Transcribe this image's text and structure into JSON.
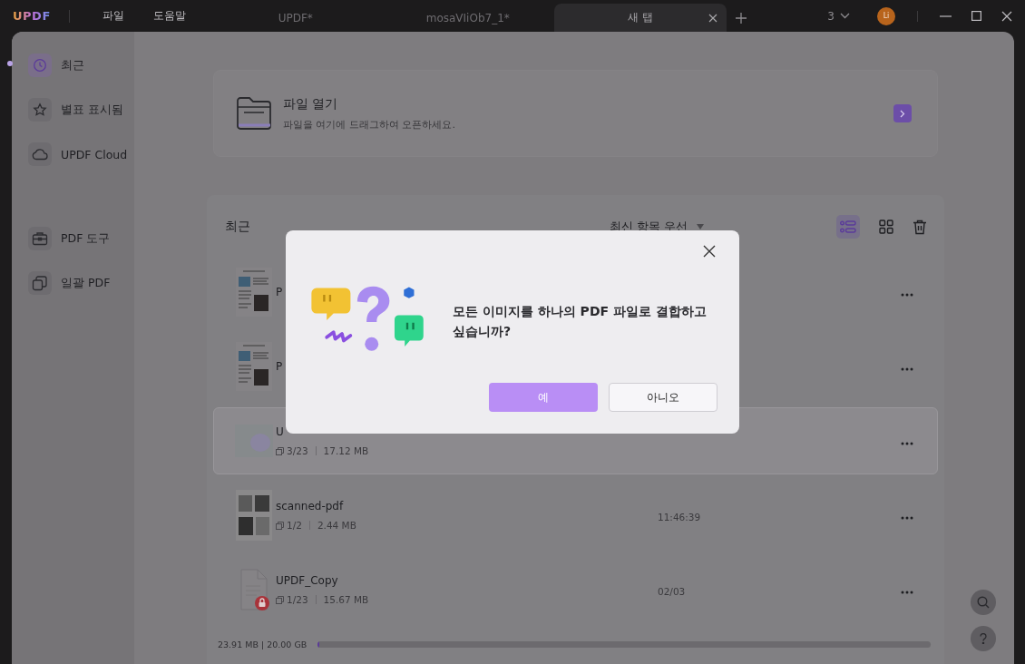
{
  "titlebar": {
    "logo": "UPDF",
    "menus": [
      "파일",
      "도움말"
    ],
    "tabs": [
      {
        "label": "UPDF*",
        "selected": false
      },
      {
        "label": "mosaVIiOb7_1*",
        "selected": false
      },
      {
        "label": "새 탭",
        "selected": true
      }
    ],
    "window_count": "3",
    "avatar": "Li"
  },
  "sidebar": {
    "items": [
      {
        "label": "최근",
        "kind": "clock",
        "selected": true
      },
      {
        "label": "별표 표시됨",
        "kind": "star",
        "selected": false
      },
      {
        "label": "UPDF Cloud",
        "kind": "cloud",
        "selected": false
      }
    ],
    "tools": [
      {
        "label": "PDF 도구",
        "kind": "toolbox",
        "selected": false
      },
      {
        "label": "일괄 PDF",
        "kind": "layers",
        "selected": false
      }
    ]
  },
  "open_file": {
    "title": "파일 열기",
    "subtitle": "파일을 여기에 드래그하여 오픈하세요."
  },
  "recent": {
    "heading": "최근",
    "sort": "최신 항목 우선",
    "views": [
      {
        "kind": "list",
        "selected": true
      },
      {
        "kind": "grid",
        "selected": false
      }
    ],
    "files": [
      {
        "name": "P",
        "kind": "article",
        "highlighted": false
      },
      {
        "name": "P",
        "kind": "article",
        "highlighted": false
      },
      {
        "name": "U",
        "kind": "blurred",
        "pages": "3/23",
        "size": "17.12 MB",
        "highlighted": true
      },
      {
        "name": "scanned-pdf",
        "kind": "scan",
        "pages": "1/2",
        "size": "2.44 MB",
        "time": "11:46:39",
        "highlighted": false
      },
      {
        "name": "UPDF_Copy",
        "kind": "locked",
        "pages": "1/23",
        "size": "15.67 MB",
        "time": "02/03",
        "highlighted": false
      }
    ]
  },
  "storage": {
    "usage": "23.91 MB | 20.00 GB",
    "level": 0.002
  },
  "dialog": {
    "message": "모든 이미지를 하나의 PDF 파일로 결합하고 싶습니까?",
    "buttons": [
      {
        "label": "예",
        "kind": "primary"
      },
      {
        "label": "아니오",
        "kind": "secondary"
      }
    ]
  }
}
